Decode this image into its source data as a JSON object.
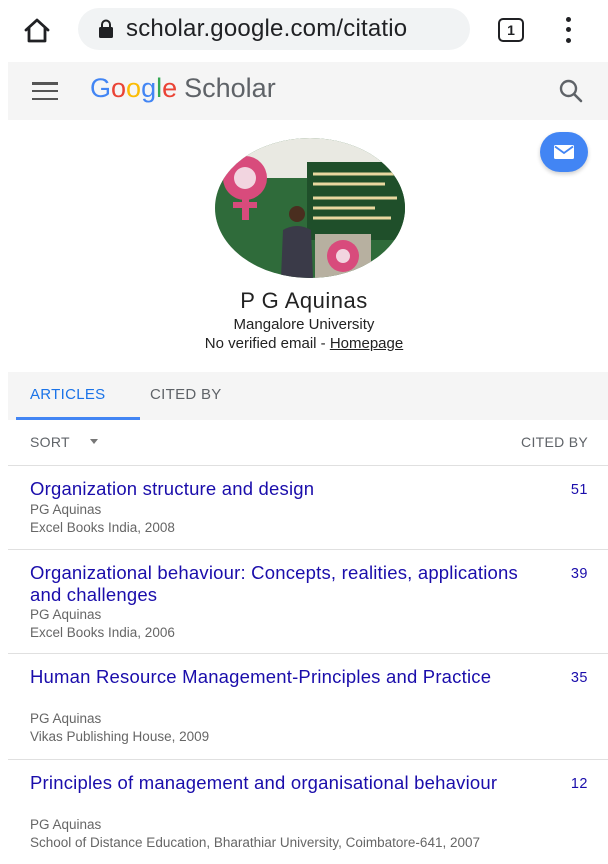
{
  "browser": {
    "url": "scholar.google.com/citatio",
    "tab_count": "1"
  },
  "header": {
    "brand_letters": [
      "G",
      "o",
      "o",
      "g",
      "l",
      "e"
    ],
    "brand_product": "Scholar"
  },
  "profile": {
    "name": "P G Aquinas",
    "affiliation": "Mangalore University",
    "email_text": "No verified email - ",
    "homepage_label": "Homepage"
  },
  "tabs": [
    {
      "label": "ARTICLES",
      "active": true
    },
    {
      "label": "CITED BY",
      "active": false
    }
  ],
  "sort": {
    "label": "SORT",
    "cited_by_header": "CITED BY"
  },
  "articles": [
    {
      "title": "Organization structure and design",
      "authors": "PG Aquinas",
      "venue": "Excel Books India, 2008",
      "cited_by": "51"
    },
    {
      "title": "Organizational behaviour: Concepts, realities, applications and challenges",
      "authors": "PG Aquinas",
      "venue": "Excel Books India, 2006",
      "cited_by": "39"
    },
    {
      "title": "Human Resource Management-Principles and Practice",
      "authors": "PG Aquinas",
      "venue": "Vikas Publishing House, 2009",
      "cited_by": "35"
    },
    {
      "title": "Principles of management and organisational behaviour",
      "authors": "PG Aquinas",
      "venue": "School of Distance Education, Bharathiar University, Coimbatore-641, 2007",
      "cited_by": "12"
    }
  ],
  "colors": {
    "link": "#1a0dab",
    "accent": "#4285f4",
    "tab_active": "#1a73e8"
  },
  "icons": [
    "home-icon",
    "lock-icon",
    "tab-switcher-icon",
    "overflow-menu-icon",
    "hamburger-menu-icon",
    "search-icon",
    "email-icon",
    "chevron-down-icon"
  ]
}
